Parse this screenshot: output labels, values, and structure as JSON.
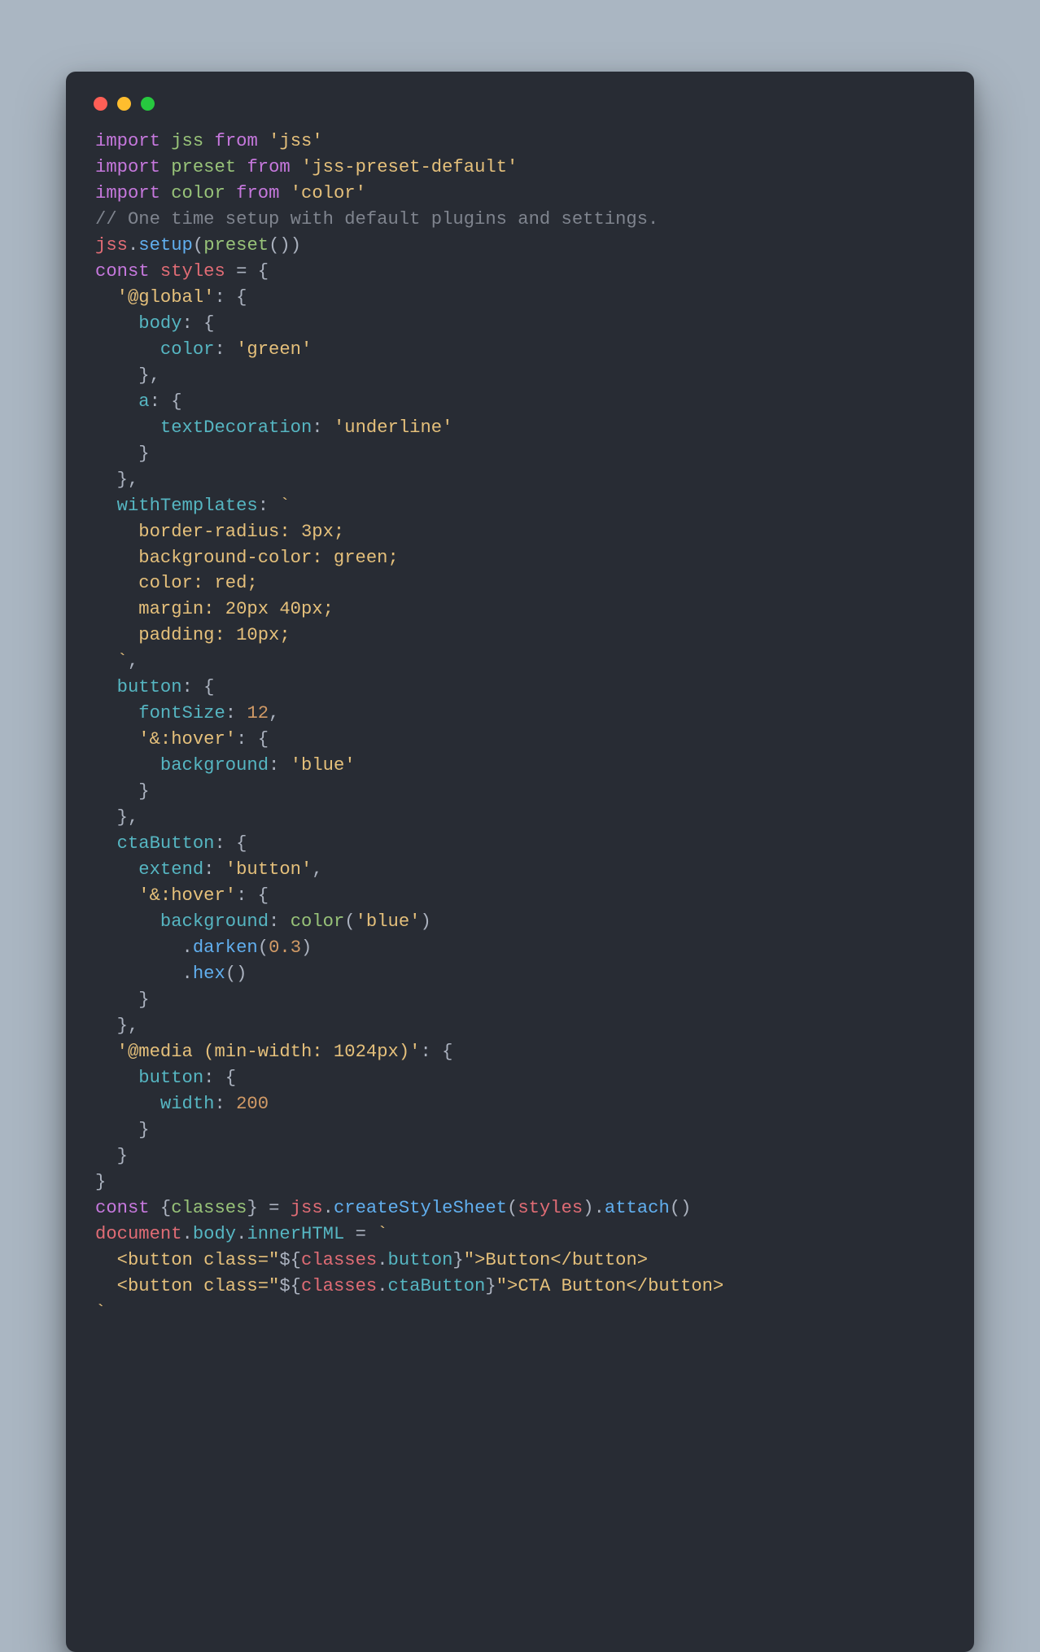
{
  "code": {
    "l01": {
      "a": "import",
      "b": "jss",
      "c": "from",
      "d": "'jss'"
    },
    "l02": {
      "a": "import",
      "b": "preset",
      "c": "from",
      "d": "'jss-preset-default'"
    },
    "l03": {
      "a": "import",
      "b": "color",
      "c": "from",
      "d": "'color'"
    },
    "l04": {
      "comment": "// One time setup with default plugins and settings."
    },
    "l05": {
      "a": "jss",
      "b": "setup",
      "c": "preset"
    },
    "l06": {
      "a": "const",
      "b": "styles"
    },
    "l07": {
      "a": "'@global'"
    },
    "l08": {
      "a": "body"
    },
    "l09": {
      "a": "color",
      "b": "'green'"
    },
    "l11": {
      "a": "a"
    },
    "l12": {
      "a": "textDecoration",
      "b": "'underline'"
    },
    "l15": {
      "a": "withTemplates"
    },
    "l16": {
      "a": "    border-radius: 3px;"
    },
    "l17": {
      "a": "    background-color: green;"
    },
    "l18": {
      "a": "    color: red;"
    },
    "l19": {
      "a": "    margin: 20px 40px;"
    },
    "l20": {
      "a": "    padding: 10px;"
    },
    "l21": {
      "a": "  "
    },
    "l22": {
      "a": "button"
    },
    "l23": {
      "a": "fontSize",
      "b": "12"
    },
    "l24": {
      "a": "'&:hover'"
    },
    "l25": {
      "a": "background",
      "b": "'blue'"
    },
    "l28": {
      "a": "ctaButton"
    },
    "l29": {
      "a": "extend",
      "b": "'button'"
    },
    "l30": {
      "a": "'&:hover'"
    },
    "l31": {
      "a": "background",
      "b": "color",
      "c": "'blue'"
    },
    "l32": {
      "a": "darken",
      "b": "0.3"
    },
    "l33": {
      "a": "hex"
    },
    "l36": {
      "a": "'@media (min-width: 1024px)'"
    },
    "l37": {
      "a": "button"
    },
    "l38": {
      "a": "width",
      "b": "200"
    },
    "l42": {
      "a": "const",
      "b": "classes",
      "c": "jss",
      "d": "createStyleSheet",
      "e": "styles",
      "f": "attach"
    },
    "l43": {
      "a": "document",
      "b": "body",
      "c": "innerHTML"
    },
    "l44": {
      "a": "  <button class=\"",
      "b": "classes",
      "c": "button",
      "d": "\">Button</button>"
    },
    "l45": {
      "a": "  <button class=\"",
      "b": "classes",
      "c": "ctaButton",
      "d": "\">CTA Button</button>"
    }
  }
}
